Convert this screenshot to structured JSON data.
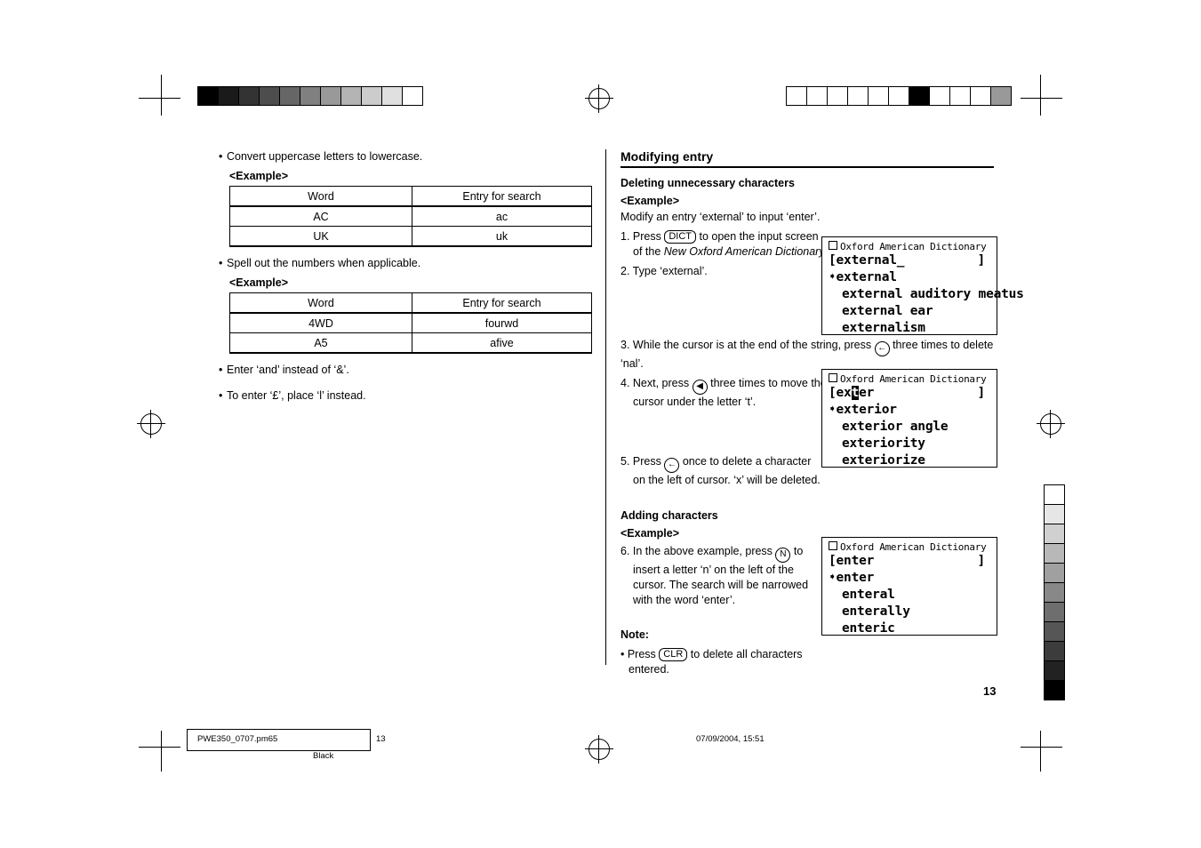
{
  "page": {
    "number": "13",
    "footer": {
      "filename": "PWE350_0707.pm65",
      "page": "13",
      "color": "Black",
      "timestamp": "07/09/2004, 15:51"
    }
  },
  "left_column": {
    "bullets": [
      "Convert uppercase letters to lowercase.",
      "Spell out the numbers when applicable."
    ],
    "example_label": "<Example>",
    "table1": {
      "headers": [
        "Word",
        "Entry for search"
      ],
      "rows": [
        [
          "AC",
          "ac"
        ],
        [
          "UK",
          "uk"
        ]
      ]
    },
    "table2": {
      "headers": [
        "Word",
        "Entry for search"
      ],
      "rows": [
        [
          "4WD",
          "fourwd"
        ],
        [
          "A5",
          "afive"
        ]
      ]
    },
    "bullets_end": [
      "Enter ‘and’ instead of ‘&’.",
      "To enter ‘£’, place ‘l’ instead."
    ]
  },
  "right_column": {
    "section_title": "Modifying entry",
    "sub1": {
      "title": "Deleting unnecessary characters",
      "example_label": "<Example>",
      "intro": "Modify an entry ‘external’ to input ‘enter’.",
      "step1_a": "1. Press",
      "step1_key": "DICT",
      "step1_b": "to open the input screen",
      "step1_c": "of the ",
      "step1_italic": "New Oxford American Dictionary",
      "step1_d": ".",
      "step2": "2. Type ‘external’.",
      "step3_a": "3. While the cursor is at the end of the string, press",
      "step3_key": "←",
      "step3_b": "three times to delete ‘nal’.",
      "step4_a": "4. Next, press",
      "step4_key": "◀",
      "step4_b": "three times to move the",
      "step4_c": "cursor under the letter ‘t’.",
      "step5_a": "5. Press",
      "step5_key": "←",
      "step5_b": "once to delete a character",
      "step5_c": "on the left of cursor. ‘x’ will be deleted."
    },
    "sub2": {
      "title": "Adding characters",
      "example_label": "<Example>",
      "step6_a": "6. In the above example, press",
      "step6_key": "N",
      "step6_b": "to",
      "step6_c": "insert a letter ‘n’ on the left of the",
      "step6_d": "cursor. The search will be narrowed",
      "step6_e": "with the word ‘enter’.",
      "note_label": "Note:",
      "note_a": "• Press",
      "note_key": "CLR",
      "note_b": "to delete all characters",
      "note_c": "entered."
    },
    "lcd1": {
      "title": "Oxford American Dictionary",
      "input": "[external_",
      "bracket_right": "]",
      "selected": "external",
      "items": [
        "external auditory meatus",
        "external ear",
        "externalism"
      ]
    },
    "lcd2": {
      "title": "Oxford American Dictionary",
      "input": "[ex",
      "cursor": "t",
      "input_rest": "er",
      "bracket_right": "]",
      "selected": "exterior",
      "items": [
        "exterior angle",
        "exteriority",
        "exteriorize"
      ]
    },
    "lcd3": {
      "title": "Oxford American Dictionary",
      "input": "[enter",
      "bracket_right": "]",
      "selected": "enter",
      "items": [
        "enteral",
        "enterally",
        "enteric"
      ]
    }
  }
}
